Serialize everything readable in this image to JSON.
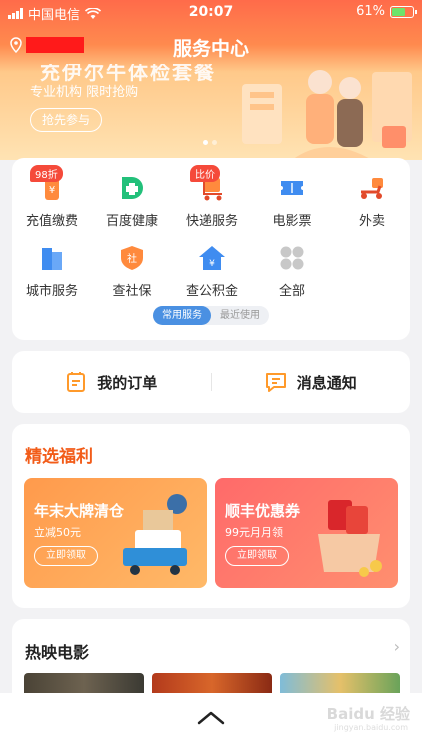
{
  "status_bar": {
    "carrier": "中国电信",
    "time": "20:07",
    "battery": "61%"
  },
  "header": {
    "title": "服务中心"
  },
  "banner": {
    "headline": "充伊尔牛体检套餐",
    "subtitle": "专业机构  限时抢购",
    "cta": "抢先参与"
  },
  "services": {
    "items": [
      {
        "label": "充值缴费",
        "tag": "98折",
        "icon": "wallet-icon",
        "color": "#ff8a3d"
      },
      {
        "label": "百度健康",
        "tag": "",
        "icon": "health-cross-icon",
        "color": "#22c07a"
      },
      {
        "label": "快递服务",
        "tag": "比价",
        "icon": "express-cart-icon",
        "color": "#ff6a3d"
      },
      {
        "label": "电影票",
        "tag": "",
        "icon": "ticket-icon",
        "color": "#3f8cf0"
      },
      {
        "label": "外卖",
        "tag": "",
        "icon": "scooter-icon",
        "color": "#ff8a3d"
      },
      {
        "label": "城市服务",
        "tag": "",
        "icon": "buildings-icon",
        "color": "#3f8cf0"
      },
      {
        "label": "查社保",
        "tag": "",
        "icon": "shield-icon",
        "color": "#ff8a3d"
      },
      {
        "label": "查公积金",
        "tag": "",
        "icon": "house-icon",
        "color": "#3f8cf0"
      },
      {
        "label": "全部",
        "tag": "",
        "icon": "grid-all-icon",
        "color": "#c8c8c8"
      }
    ],
    "segment": {
      "active": "常用服务",
      "inactive": "最近使用"
    }
  },
  "quick_links": {
    "orders": "我的订单",
    "messages": "消息通知"
  },
  "welfare": {
    "title": "精选福利",
    "promos": [
      {
        "title": "年末大牌清仓",
        "subtitle": "立减50元",
        "button": "立即领取"
      },
      {
        "title": "顺丰优惠券",
        "subtitle": "99元月月领",
        "button": "立即领取"
      }
    ]
  },
  "movies": {
    "title": "热映电影"
  },
  "watermark": {
    "text": "Baidu 经验",
    "sub": "jingyan.baidu.com"
  }
}
